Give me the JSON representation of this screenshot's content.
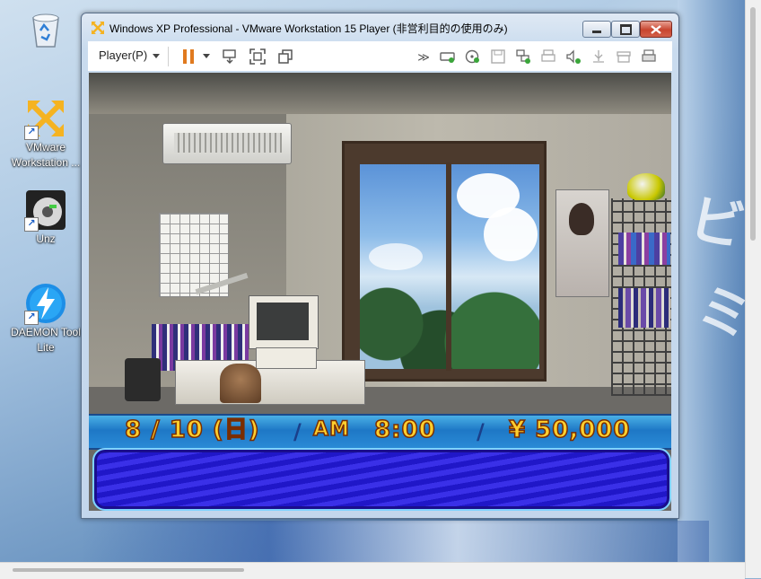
{
  "desktop": {
    "icons": [
      {
        "label_line1": "",
        "label_line2": ""
      },
      {
        "label_line1": "VMware",
        "label_line2": "Workstation ..."
      },
      {
        "label_line1": "Unz",
        "label_line2": ""
      },
      {
        "label_line1": "DAEMON Tool",
        "label_line2": "Lite"
      }
    ]
  },
  "window": {
    "title": "Windows XP Professional - VMware Workstation 15 Player (非営利目的の使用のみ)",
    "toolbar": {
      "player_menu": "Player(P)",
      "icons": [
        "send-ctrl-alt-del-icon",
        "fullscreen-icon",
        "unity-icon",
        "expand-icon",
        "hard-disk-icon",
        "cd-dvd-icon",
        "floppy-icon",
        "network-icon",
        "printer-icon",
        "sound-icon",
        "usb-icon",
        "drive-icon",
        "printer2-icon"
      ]
    }
  },
  "game": {
    "date": "8 / 10 (日)",
    "date_month": "8",
    "date_day": "10",
    "date_dow": "(日)",
    "ampm": "AM",
    "time": "8:00",
    "money": "¥ 50,000"
  },
  "colors": {
    "title_close": "#c8452f",
    "pause_accent": "#e07a1f",
    "game_bar": "#1e78c6",
    "game_text": "#ffcf2e"
  }
}
